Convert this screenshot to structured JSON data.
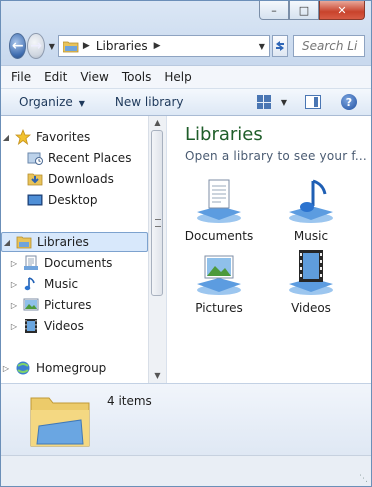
{
  "window": {
    "minimize_glyph": "–",
    "maximize_glyph": "□",
    "close_glyph": "✕"
  },
  "address_bar": {
    "location": "Libraries",
    "search_placeholder": "Search Li"
  },
  "menu": [
    "File",
    "Edit",
    "View",
    "Tools",
    "Help"
  ],
  "toolbar": {
    "organize_label": "Organize",
    "new_library_label": "New library"
  },
  "nav_pane": {
    "favorites_label": "Favorites",
    "favorites": [
      "Recent Places",
      "Downloads",
      "Desktop"
    ],
    "libraries_label": "Libraries",
    "libraries": [
      "Documents",
      "Music",
      "Pictures",
      "Videos"
    ],
    "homegroup_label": "Homegroup"
  },
  "content": {
    "title": "Libraries",
    "subtitle": "Open a library to see your f...",
    "items": [
      {
        "label": "Documents",
        "icon": "documents-library-icon"
      },
      {
        "label": "Music",
        "icon": "music-library-icon"
      },
      {
        "label": "Pictures",
        "icon": "pictures-library-icon"
      },
      {
        "label": "Videos",
        "icon": "videos-library-icon"
      }
    ]
  },
  "details": {
    "item_count": "4 items"
  },
  "colors": {
    "title_green": "#1e5d29",
    "selection_bg": "#d8e8fb",
    "chrome_blue": "#c9d9ee"
  }
}
